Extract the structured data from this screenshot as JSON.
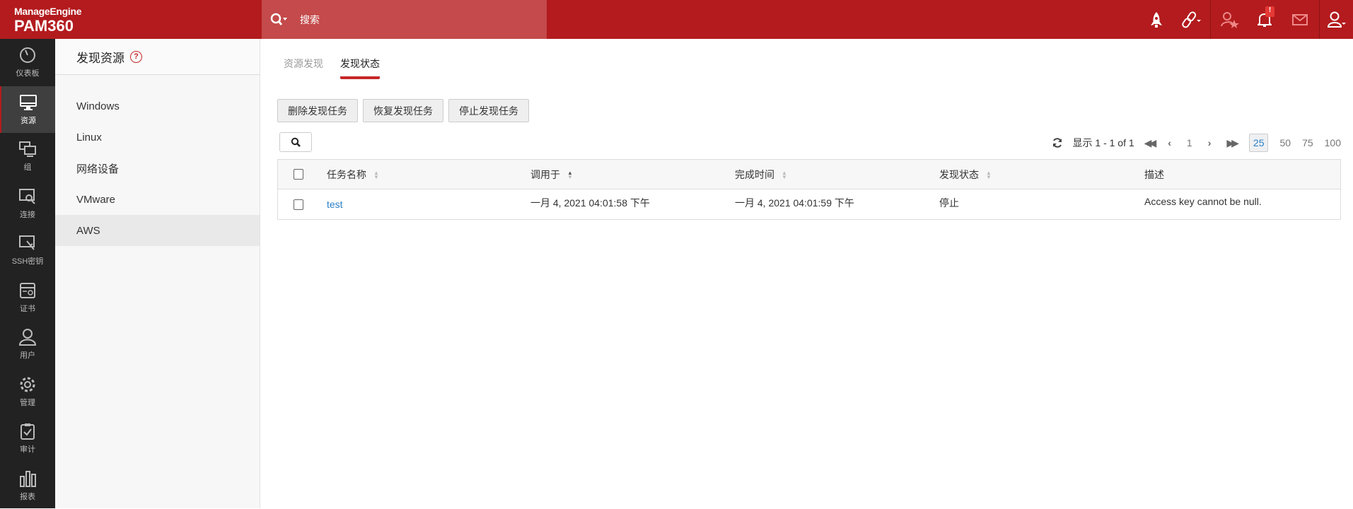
{
  "header": {
    "brand": "ManageEngine",
    "product": "PAM360",
    "search_placeholder": "搜索",
    "notification_badge": "!"
  },
  "nav": [
    {
      "label": "仪表板",
      "icon": "dashboard-icon"
    },
    {
      "label": "资源",
      "icon": "monitor-icon",
      "active": true
    },
    {
      "label": "组",
      "icon": "group-icon"
    },
    {
      "label": "连接",
      "icon": "connection-icon"
    },
    {
      "label": "SSH密钥",
      "icon": "ssh-key-icon"
    },
    {
      "label": "证书",
      "icon": "certificate-icon"
    },
    {
      "label": "用户",
      "icon": "user-icon"
    },
    {
      "label": "管理",
      "icon": "gear-icon"
    },
    {
      "label": "审计",
      "icon": "clipboard-icon"
    },
    {
      "label": "报表",
      "icon": "bar-chart-icon"
    }
  ],
  "submenu": {
    "title": "发现资源",
    "help": "?",
    "items": [
      "Windows",
      "Linux",
      "网络设备",
      "VMware",
      "AWS"
    ],
    "active": "AWS"
  },
  "tabs": [
    "资源发现",
    "发现状态"
  ],
  "actions": [
    "删除发现任务",
    "恢复发现任务",
    "停止发现任务"
  ],
  "pagination": {
    "summary": "显示 1 - 1 of 1",
    "page": "1",
    "page_sizes": [
      "25",
      "50",
      "75",
      "100"
    ],
    "selected_size": "25"
  },
  "table": {
    "columns": [
      "任务名称",
      "调用于",
      "完成时间",
      "发现状态",
      "描述"
    ],
    "rows": [
      {
        "name": "test",
        "invoked": "一月 4, 2021 04:01:58 下午",
        "completed": "一月 4, 2021 04:01:59 下午",
        "status": "停止",
        "description": "Access key cannot be null."
      }
    ]
  },
  "colors": {
    "brand": "#b31b1e",
    "link": "#2a7fc9"
  }
}
